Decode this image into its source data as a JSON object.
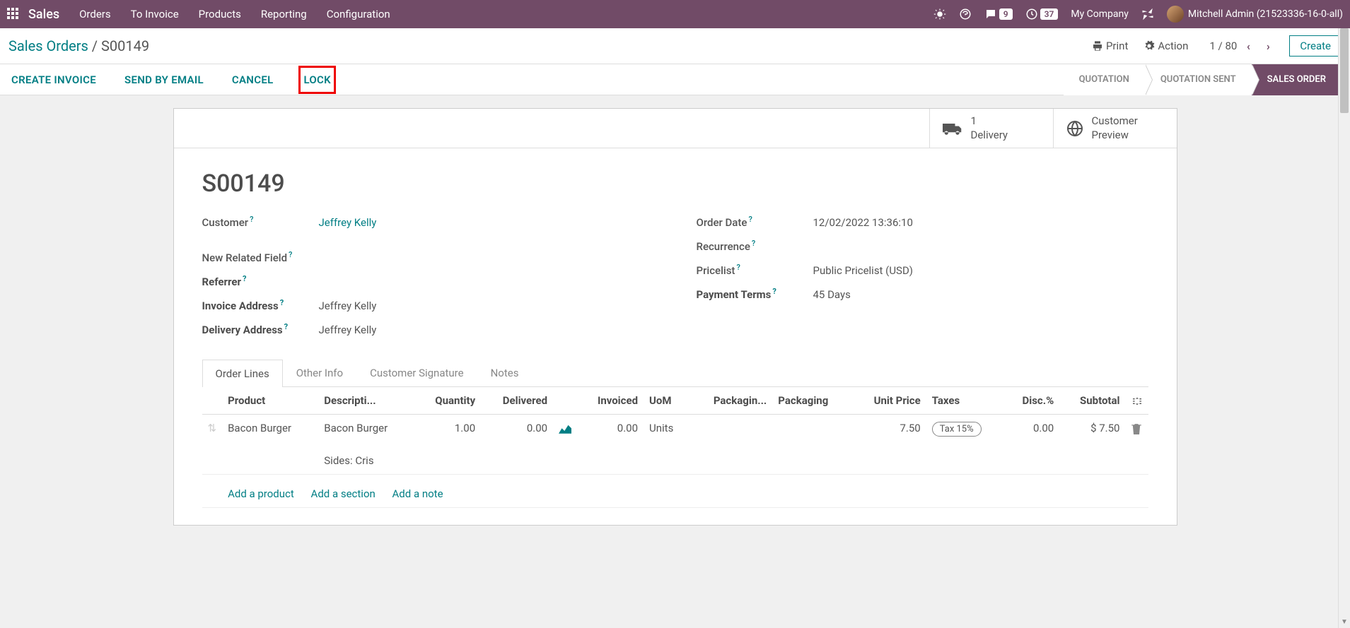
{
  "topbar": {
    "brand": "Sales",
    "menu": [
      "Orders",
      "To Invoice",
      "Products",
      "Reporting",
      "Configuration"
    ],
    "chat_count": "9",
    "activity_count": "37",
    "company": "My Company",
    "user": "Mitchell Admin (21523336-16-0-all)"
  },
  "header": {
    "breadcrumb_root": "Sales Orders",
    "breadcrumb_sep": " / ",
    "breadcrumb_current": "S00149",
    "print": "Print",
    "action": "Action",
    "pager": "1 / 80",
    "create": "Create"
  },
  "actions": {
    "create_invoice": "CREATE INVOICE",
    "send_email": "SEND BY EMAIL",
    "cancel": "CANCEL",
    "lock": "LOCK"
  },
  "status": {
    "quotation": "QUOTATION",
    "quotation_sent": "QUOTATION SENT",
    "sales_order": "SALES ORDER"
  },
  "stats": {
    "delivery_count": "1",
    "delivery_label": "Delivery",
    "preview_label1": "Customer",
    "preview_label2": "Preview"
  },
  "record": {
    "name": "S00149",
    "left": {
      "customer_label": "Customer",
      "customer_value": "Jeffrey Kelly",
      "new_related_label": "New Related Field",
      "referrer_label": "Referrer",
      "invoice_addr_label": "Invoice Address",
      "invoice_addr_value": "Jeffrey Kelly",
      "delivery_addr_label": "Delivery Address",
      "delivery_addr_value": "Jeffrey Kelly"
    },
    "right": {
      "order_date_label": "Order Date",
      "order_date_value": "12/02/2022 13:36:10",
      "recurrence_label": "Recurrence",
      "pricelist_label": "Pricelist",
      "pricelist_value": "Public Pricelist (USD)",
      "payment_terms_label": "Payment Terms",
      "payment_terms_value": "45 Days"
    }
  },
  "tabs": {
    "order_lines": "Order Lines",
    "other_info": "Other Info",
    "customer_signature": "Customer Signature",
    "notes": "Notes"
  },
  "table": {
    "headers": {
      "product": "Product",
      "description": "Descripti...",
      "quantity": "Quantity",
      "delivered": "Delivered",
      "invoiced": "Invoiced",
      "uom": "UoM",
      "packaging1": "Packagin...",
      "packaging2": "Packaging",
      "unit_price": "Unit Price",
      "taxes": "Taxes",
      "disc": "Disc.%",
      "subtotal": "Subtotal"
    },
    "rows": [
      {
        "product": "Bacon Burger",
        "description": "Bacon Burger",
        "description2": "Sides: Cris",
        "quantity": "1.00",
        "delivered": "0.00",
        "invoiced": "0.00",
        "uom": "Units",
        "unit_price": "7.50",
        "tax": "Tax 15%",
        "disc": "0.00",
        "subtotal": "$ 7.50"
      }
    ],
    "add_product": "Add a product",
    "add_section": "Add a section",
    "add_note": "Add a note"
  }
}
